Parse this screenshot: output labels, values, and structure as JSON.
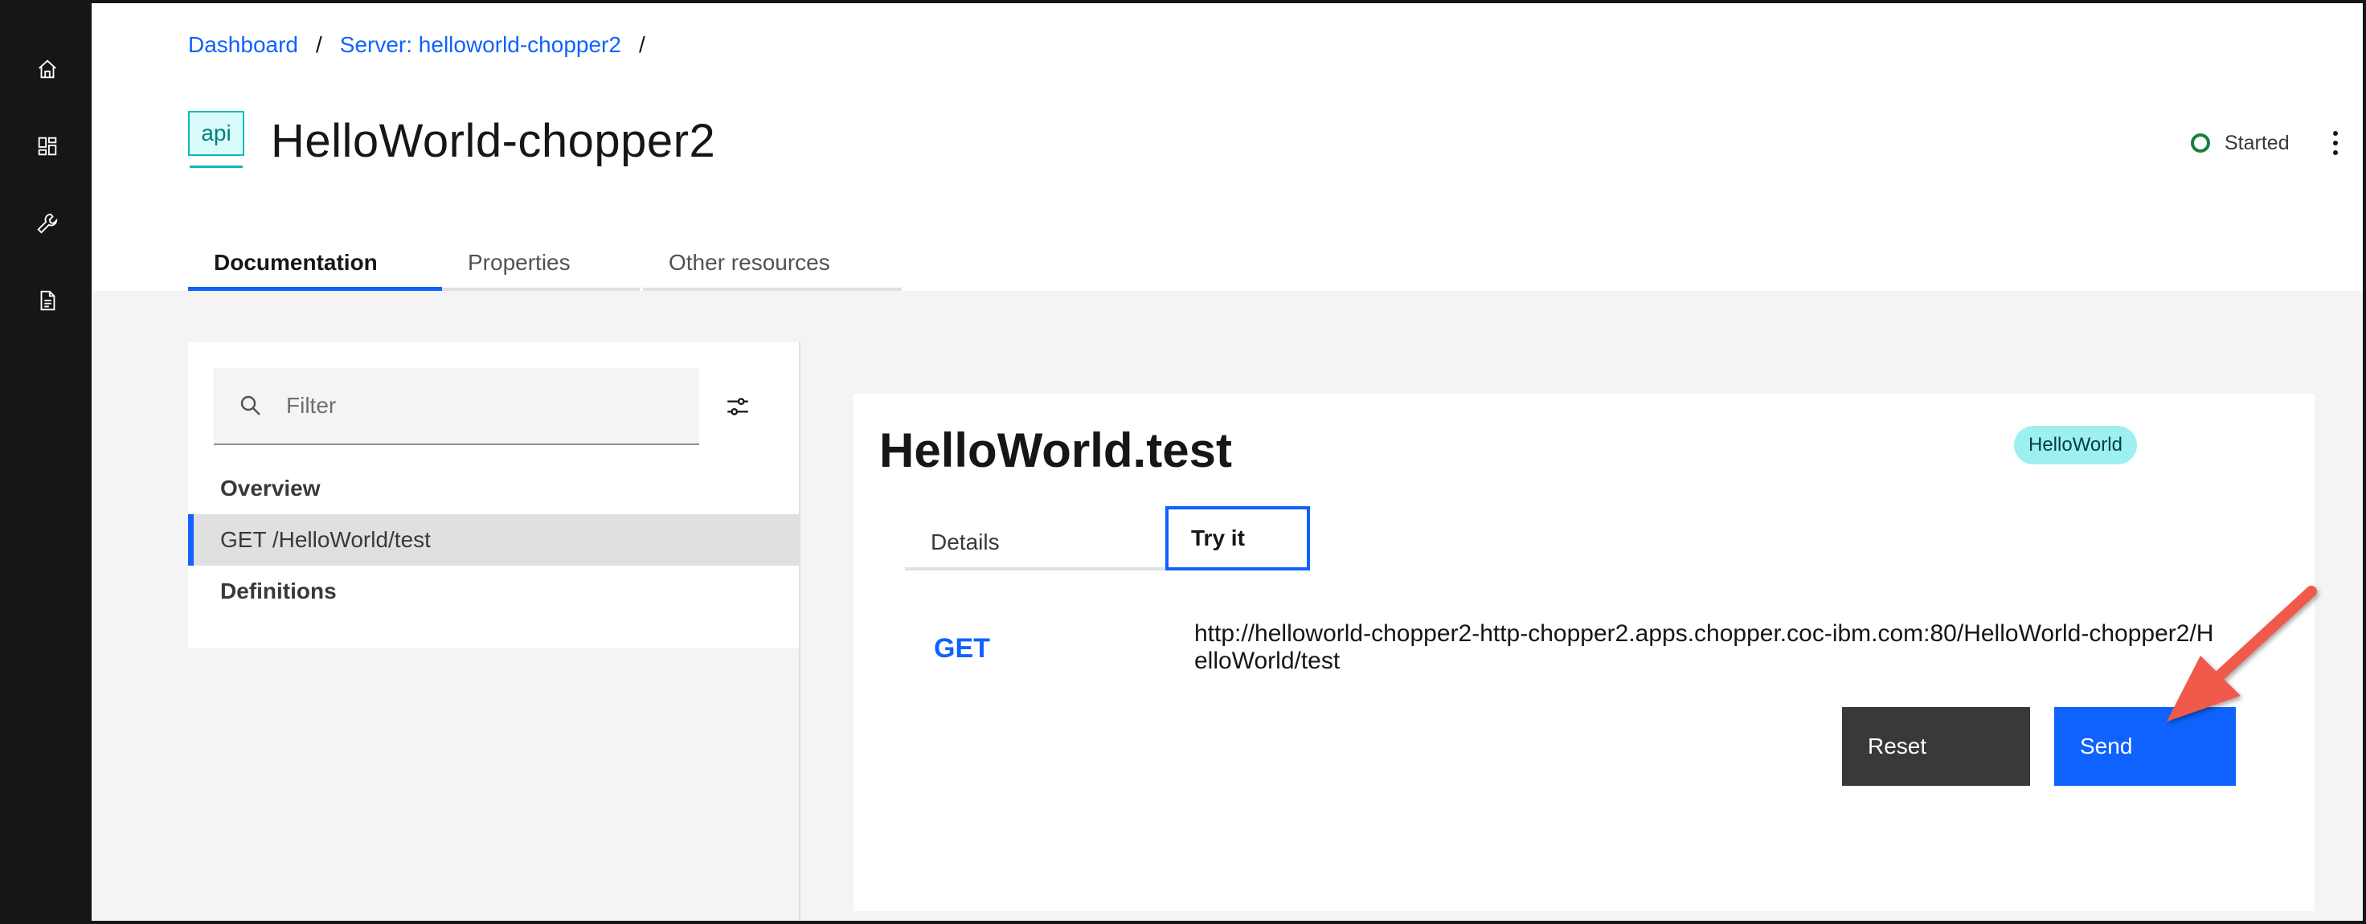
{
  "breadcrumb": {
    "items": [
      "Dashboard",
      "Server: helloworld-chopper2"
    ],
    "separator": "/"
  },
  "header": {
    "icon_label": "api",
    "title": "HelloWorld-chopper2",
    "status": "Started",
    "status_color": "#198038"
  },
  "tabs": [
    {
      "label": "Documentation",
      "active": true
    },
    {
      "label": "Properties",
      "active": false
    },
    {
      "label": "Other resources",
      "active": false
    }
  ],
  "sidebar": {
    "filter_placeholder": "Filter",
    "items": [
      {
        "label": "Overview",
        "type": "heading"
      },
      {
        "label": "GET /HelloWorld/test",
        "type": "item",
        "selected": true
      },
      {
        "label": "Definitions",
        "type": "heading"
      }
    ]
  },
  "operation": {
    "title": "HelloWorld.test",
    "tag": "HelloWorld",
    "subtabs": [
      {
        "label": "Details",
        "active": false
      },
      {
        "label": "Try it",
        "active": true
      }
    ],
    "method": "GET",
    "url": "http://helloworld-chopper2-http-chopper2.apps.chopper.coc-ibm.com:80/HelloWorld-chopper2/HelloWorld/test",
    "reset_label": "Reset",
    "send_label": "Send"
  },
  "colors": {
    "accent": "#0f62fe",
    "rail": "#161616",
    "tag_bg": "#9ef0f0",
    "annotation_arrow": "#f05a4b"
  },
  "icons": {
    "rail": [
      "home-icon",
      "dashboard-icon",
      "wrench-icon",
      "document-icon"
    ],
    "filter": "search-icon",
    "filter_settings": "sliders-icon",
    "overflow": "overflow-menu-icon"
  }
}
